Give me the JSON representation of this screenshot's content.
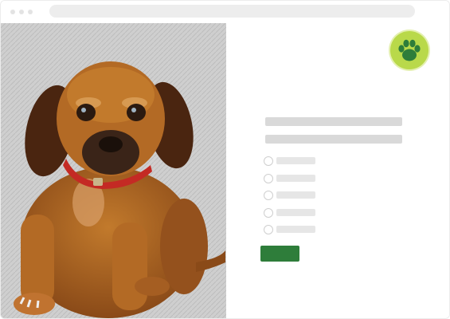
{
  "window": {
    "traffic_lights": [
      "close",
      "minimize",
      "maximize"
    ]
  },
  "photo": {
    "icon": "puppy-photo"
  },
  "logo": {
    "icon": "paw-print-icon",
    "badge_color": "#b9d94a",
    "paw_color": "#2e7d3a"
  },
  "form": {
    "option_count": 5,
    "accent_color": "#2e7d3a"
  }
}
